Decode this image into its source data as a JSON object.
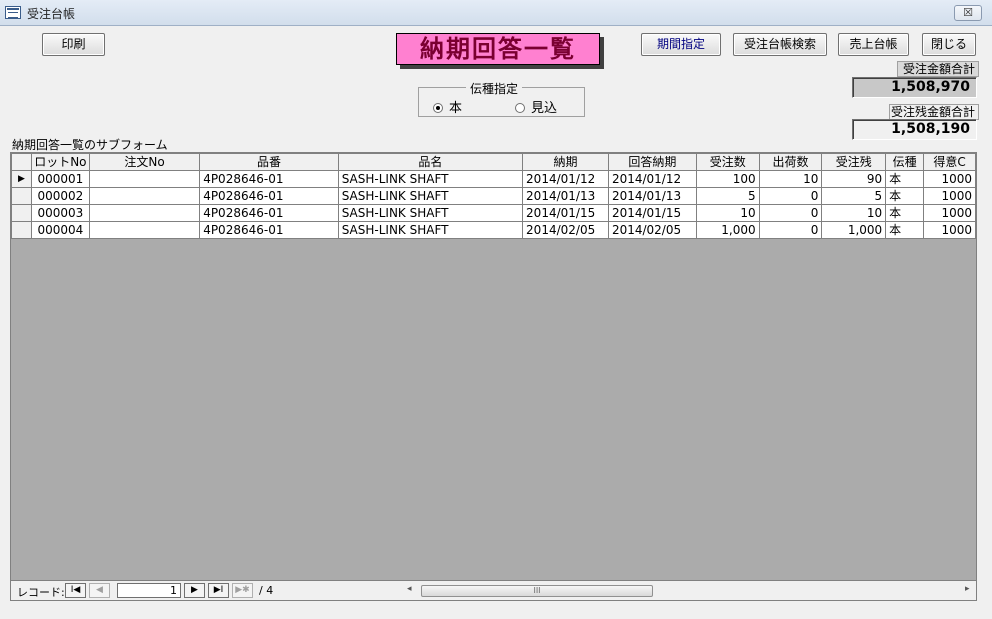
{
  "window": {
    "title": "受注台帳",
    "close_glyph": "☒"
  },
  "toolbar": {
    "print_label": "印刷",
    "period_label": "期間指定",
    "search_label": "受注台帳検索",
    "sales_label": "売上台帳",
    "close_label": "閉じる"
  },
  "page_title": "納期回答一覧",
  "totals": {
    "order_amount_label": "受注金額合計",
    "order_amount_value": "1,508,970",
    "remaining_label": "受注残金額合計",
    "remaining_value": "1,508,190"
  },
  "slip_type": {
    "label": "伝種指定",
    "options": [
      {
        "label": "本",
        "selected": true
      },
      {
        "label": "見込",
        "selected": false
      }
    ]
  },
  "subform_label": "納期回答一覧のサブフォーム",
  "grid": {
    "columns": [
      "ロットNo",
      "注文No",
      "品番",
      "品名",
      "納期",
      "回答納期",
      "受注数",
      "出荷数",
      "受注残",
      "伝種",
      "得意C"
    ],
    "rows": [
      [
        "000001",
        "",
        "4P028646-01",
        "SASH-LINK SHAFT",
        "2014/01/12",
        "2014/01/12",
        "100",
        "10",
        "90",
        "本",
        "1000"
      ],
      [
        "000002",
        "",
        "4P028646-01",
        "SASH-LINK SHAFT",
        "2014/01/13",
        "2014/01/13",
        "5",
        "0",
        "5",
        "本",
        "1000"
      ],
      [
        "000003",
        "",
        "4P028646-01",
        "SASH-LINK SHAFT",
        "2014/01/15",
        "2014/01/15",
        "10",
        "0",
        "10",
        "本",
        "1000"
      ],
      [
        "000004",
        "",
        "4P028646-01",
        "SASH-LINK SHAFT",
        "2014/02/05",
        "2014/02/05",
        "1,000",
        "0",
        "1,000",
        "本",
        "1000"
      ]
    ],
    "current_row_marker": "▶"
  },
  "navigation": {
    "label": "レコード:",
    "current": "1",
    "total": "/ 4",
    "first_glyph": "I◀",
    "prev_glyph": "◀",
    "next_glyph": "▶",
    "last_glyph": "▶I",
    "new_glyph": "▶✱",
    "scroll_left": "◂",
    "scroll_right": "▸",
    "scroll_grip": "III"
  }
}
